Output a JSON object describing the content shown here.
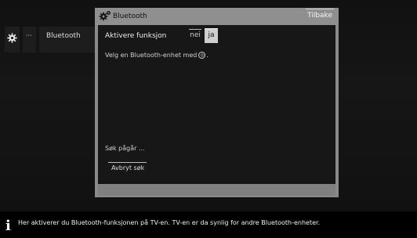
{
  "breadcrumb": {
    "settings_icon": "gear-icon",
    "ellipsis_label": "···",
    "current_label": "Bluetooth"
  },
  "panel": {
    "title": "Bluetooth",
    "title_icon": "bluetooth-gear-icon",
    "back_label": "Tilbake",
    "activate_label": "Aktivere funksjon",
    "toggle": {
      "no_label": "nei",
      "yes_label": "ja",
      "selected": "ja"
    },
    "hint_prefix": "Velg en Bluetooth-enhet med",
    "hint_glyph": "OK",
    "hint_suffix": ".",
    "search_status": "Søk pågår ...",
    "cancel_search_label": "Avbryt søk"
  },
  "info": {
    "icon": "info-icon",
    "text": "Her aktiverer du Bluetooth-funksjonen på TV-en. TV-en er da synlig for andre Bluetooth-enheter."
  }
}
